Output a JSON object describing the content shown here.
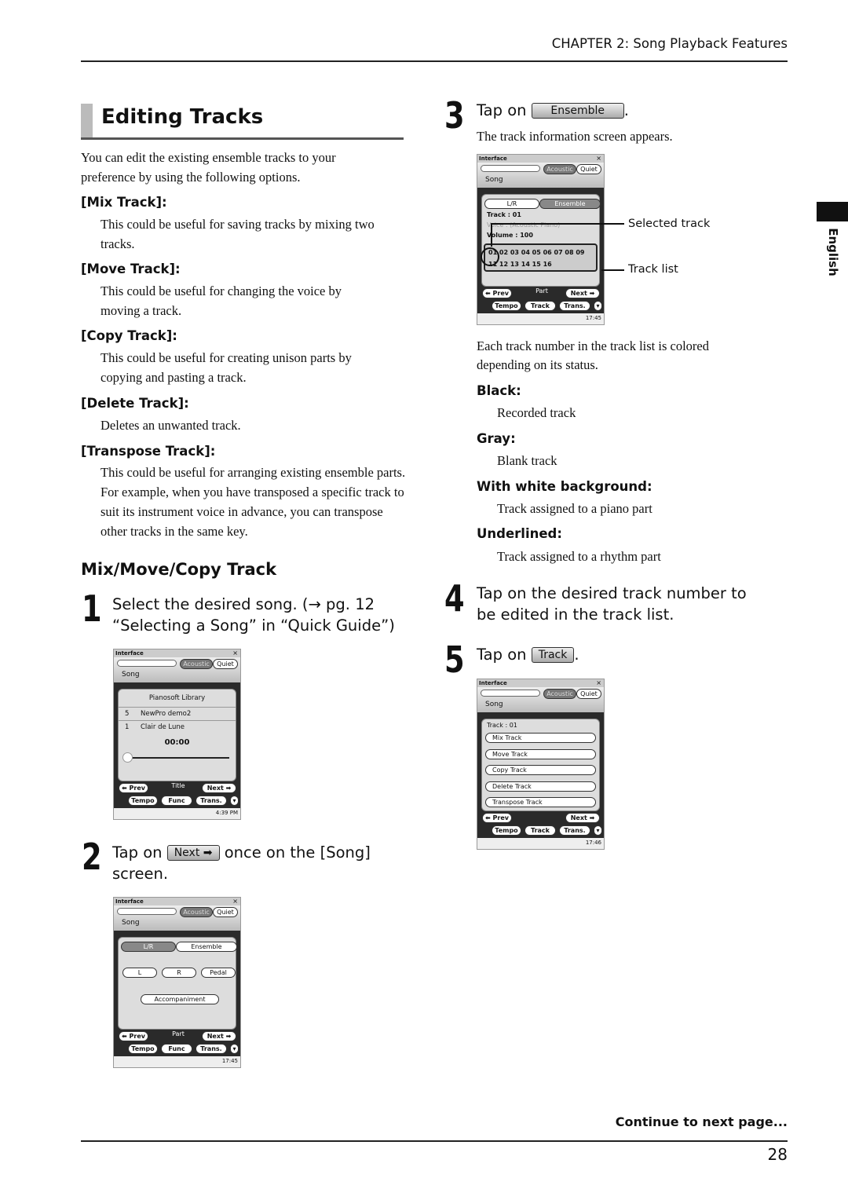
{
  "header": {
    "chapter": "CHAPTER 2: Song Playback Features"
  },
  "section": {
    "title": "Editing Tracks",
    "intro": [
      "You can edit the existing ensemble tracks to your",
      "preference by using the following options."
    ],
    "options": [
      {
        "term": "[Mix Track]:",
        "desc": "This could be useful for saving tracks by mixing two tracks."
      },
      {
        "term": "[Move Track]:",
        "desc": "This could be useful for changing the voice by moving a track."
      },
      {
        "term": "[Copy Track]:",
        "desc": "This could be useful for creating unison parts by copying and pasting a track."
      },
      {
        "term": "[Delete Track]:",
        "desc": "Deletes an unwanted track."
      },
      {
        "term": "[Transpose Track]:",
        "desc": "This could be useful for arranging existing ensemble parts. For example, when you have transposed a specific track to suit its instrument voice in advance, you can transpose other tracks in the same key."
      }
    ]
  },
  "subsection": {
    "title": "Mix/Move/Copy Track"
  },
  "steps": [
    {
      "num": "1",
      "lines": [
        "Select the desired song. (→ pg. 12",
        "“Selecting a Song” in “Quick Guide”)"
      ]
    },
    {
      "num": "2",
      "pre": "Tap on",
      "button": "Next ➡",
      "post": "once on the [Song]",
      "line2": "screen."
    },
    {
      "num": "3",
      "pre": "Tap on",
      "button": "Ensemble",
      "post": ".",
      "result": "The track information screen appears."
    },
    {
      "num": "4",
      "lines": [
        "Tap on the desired track number to",
        "be edited in the track list."
      ]
    },
    {
      "num": "5",
      "pre": "Tap on",
      "button": "Track",
      "post": "."
    }
  ],
  "callouts": {
    "selected": "Selected track",
    "list": "Track list"
  },
  "colors_note": {
    "intro": [
      "Each track number in the track list is colored",
      "depending on its status."
    ],
    "items": [
      {
        "term": "Black:",
        "desc": "Recorded track"
      },
      {
        "term": "Gray:",
        "desc": "Blank track"
      },
      {
        "term": "With white background:",
        "desc": "Track assigned to a piano part"
      },
      {
        "term": "Underlined:",
        "desc": "Track assigned to a rhythm part"
      }
    ]
  },
  "screens": {
    "common": {
      "title": "Interface",
      "acoustic": "Acoustic",
      "quiet": "Quiet",
      "song": "Song",
      "prev": "⬅ Prev",
      "next": "Next ➡",
      "tempo": "Tempo",
      "trans": "Trans.",
      "close": "×"
    },
    "s1": {
      "library": "Pianosoft Library",
      "rows": [
        [
          "5",
          "NewPro demo2"
        ],
        [
          "1",
          "Clair de Lune"
        ]
      ],
      "time": "00:00",
      "mid": "Title",
      "func": "Func",
      "clock": "4:39 PM"
    },
    "s2": {
      "tabs": [
        "L/R",
        "Ensemble"
      ],
      "buttons": [
        "L",
        "R",
        "Pedal"
      ],
      "accomp": "Accompaniment",
      "mid": "Part",
      "func": "Func",
      "clock": "17:45"
    },
    "s3": {
      "tabs": [
        "L/R",
        "Ensemble"
      ],
      "track": "Track    : 01",
      "voice": "Voice    : (Acoustic Piano)",
      "volume": "Volume  : 100",
      "row1": [
        "01",
        "02",
        "03",
        "04",
        "05",
        "06",
        "07",
        "08",
        "09"
      ],
      "row2": [
        "11",
        "12",
        "13",
        "14",
        "15",
        "16"
      ],
      "mid": "Part",
      "track_btn": "Track",
      "clock": "17:45"
    },
    "s4": {
      "header": "Track : 01",
      "menu": [
        "Mix Track",
        "Move Track",
        "Copy Track",
        "Delete Track",
        "Transpose Track"
      ],
      "track_btn": "Track",
      "clock": "17:46"
    }
  },
  "side_tab": "English",
  "footer": {
    "continue": "Continue to next page...",
    "page": "28"
  }
}
